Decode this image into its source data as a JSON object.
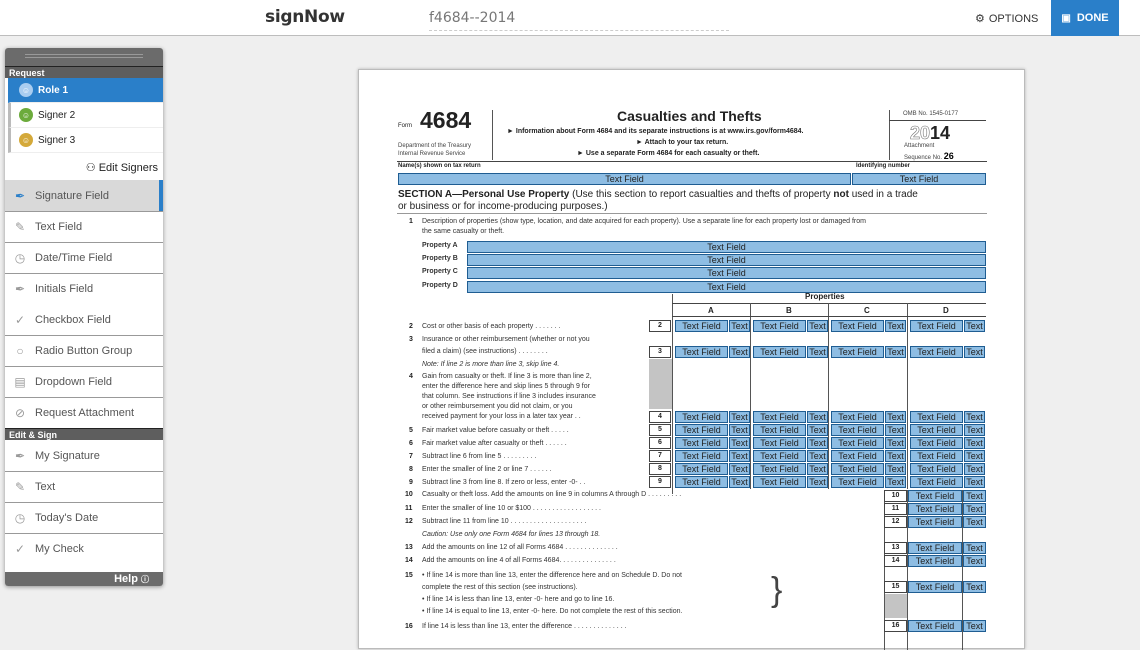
{
  "header": {
    "brand": "signNow",
    "document_name": "f4684--2014",
    "options_label": "OPTIONS",
    "done_label": "DONE",
    "accent": "#2a7fc9"
  },
  "panel": {
    "request_title": "Request",
    "roles": [
      {
        "label": "Role 1",
        "color": "#a9cdf0",
        "active": true
      },
      {
        "label": "Signer 2",
        "color": "#6cab3c",
        "active": false
      },
      {
        "label": "Signer 3",
        "color": "#d4a93a",
        "active": false
      }
    ],
    "edit_signers": "Edit Signers",
    "request_tools": [
      {
        "label": "Signature Field",
        "icon": "pen-nib-icon",
        "selected": true
      },
      {
        "label": "Text Field",
        "icon": "pencil-icon"
      },
      {
        "label": "Date/Time Field",
        "icon": "clock-icon"
      },
      {
        "label": "Initials Field",
        "icon": "pen-nib-icon"
      },
      {
        "label": "Checkbox Field",
        "icon": "check-icon"
      },
      {
        "label": "Radio Button Group",
        "icon": "radio-icon"
      },
      {
        "label": "Dropdown Field",
        "icon": "dropdown-icon"
      },
      {
        "label": "Request Attachment",
        "icon": "paperclip-icon"
      }
    ],
    "edit_sign_title": "Edit & Sign",
    "edit_tools": [
      {
        "label": "My Signature",
        "icon": "pen-nib-icon"
      },
      {
        "label": "Text",
        "icon": "pencil-icon"
      },
      {
        "label": "Today's Date",
        "icon": "clock-icon"
      },
      {
        "label": "My Check",
        "icon": "check-icon"
      }
    ],
    "help": "Help"
  },
  "form": {
    "form_word": "Form",
    "form_number": "4684",
    "dept1": "Department of the Treasury",
    "dept2": "Internal Revenue Service",
    "title": "Casualties and Thefts",
    "info1": "► Information about Form 4684 and its separate instructions is at www.irs.gov/form4684.",
    "info2": "► Attach to your tax return.",
    "info3": "► Use a separate Form 4684 for each casualty or theft.",
    "omb": "OMB No. 1545-0177",
    "year_a": "20",
    "year_b": "14",
    "attachment": "Attachment",
    "sequence": "Sequence No.",
    "seq_no": "26",
    "names_label": "Name(s) shown on tax return",
    "id_label": "Identifying number",
    "field_label": "Text Field",
    "field_short": "Text",
    "section_a": "SECTION A—Personal Use Property",
    "section_a_text": "(Use this section to report casualties and thefts of property",
    "not_word": "not",
    "section_a_text2": "used in a trade",
    "section_a_line2": "or business or for income-producing purposes.)",
    "line1a": "Description of properties (show type, location, and date acquired for each property). Use a separate line for each property lost or damaged from",
    "line1b": "the same casualty or theft.",
    "properties": [
      "Property A",
      "Property B",
      "Property C",
      "Property D"
    ],
    "properties_header": "Properties",
    "columns": [
      "A",
      "B",
      "C",
      "D"
    ],
    "lines": [
      {
        "n": "2",
        "t": "Cost or other basis of each property . . . . . . ."
      },
      {
        "n": "3",
        "t": "Insurance or other reimbursement (whether or not you",
        "t2": "filed a claim) (see instructions) . . . . . . . ."
      },
      {
        "n": "",
        "t": "Note: If line 2 is more than line 3, skip line 4."
      },
      {
        "n": "4",
        "t": "Gain from casualty or theft. If line 3 is more than line 2,",
        "t2": "enter the difference here and skip lines 5 through 9 for",
        "t3": "that column. See instructions if line 3 includes insurance",
        "t4": "or other reimbursement you did not claim, or you",
        "t5": "received payment for your loss in a later tax year . ."
      },
      {
        "n": "5",
        "t": "Fair market value before casualty or theft . . . . ."
      },
      {
        "n": "6",
        "t": "Fair market value after casualty or theft . . . . . ."
      },
      {
        "n": "7",
        "t": "Subtract line 6 from line 5 . . . . . . . . ."
      },
      {
        "n": "8",
        "t": "Enter the smaller of line 2 or line 7 . . . . . ."
      },
      {
        "n": "9",
        "t": "Subtract line 3 from line 8. If zero or less, enter -0- . ."
      },
      {
        "n": "10",
        "t": "Casualty or theft loss. Add the amounts on line 9 in columns A through D . . . . . . . . ."
      },
      {
        "n": "11",
        "t": "Enter the smaller of line 10 or $100 . . . . . . . . . . . . . . . . . ."
      },
      {
        "n": "12",
        "t": "Subtract line 11 from line 10 . . . . . . . . . . . . . . . . . . . ."
      },
      {
        "n": "",
        "t": "Caution: Use only one Form 4684 for lines 13 through 18."
      },
      {
        "n": "13",
        "t": "Add the amounts on line 12 of all Forms 4684 . . . . . . . . . . . . . ."
      },
      {
        "n": "14",
        "t": "Add the amounts on line 4 of all Forms 4684. . . . . . . . . . . . . . ."
      },
      {
        "n": "15",
        "t": "• If line 14 is more than line 13, enter the difference here and on Schedule D. Do not",
        "t2": "complete the rest of this section (see instructions).",
        "t3": "• If line 14 is less than line 13, enter -0- here and go to line 16.",
        "t4": "• If line 14 is equal to line 13, enter -0- here. Do not complete the rest of this section."
      },
      {
        "n": "16",
        "t": "If line 14 is less than line 13, enter the difference . . . . . . . . . . . . . ."
      }
    ]
  }
}
